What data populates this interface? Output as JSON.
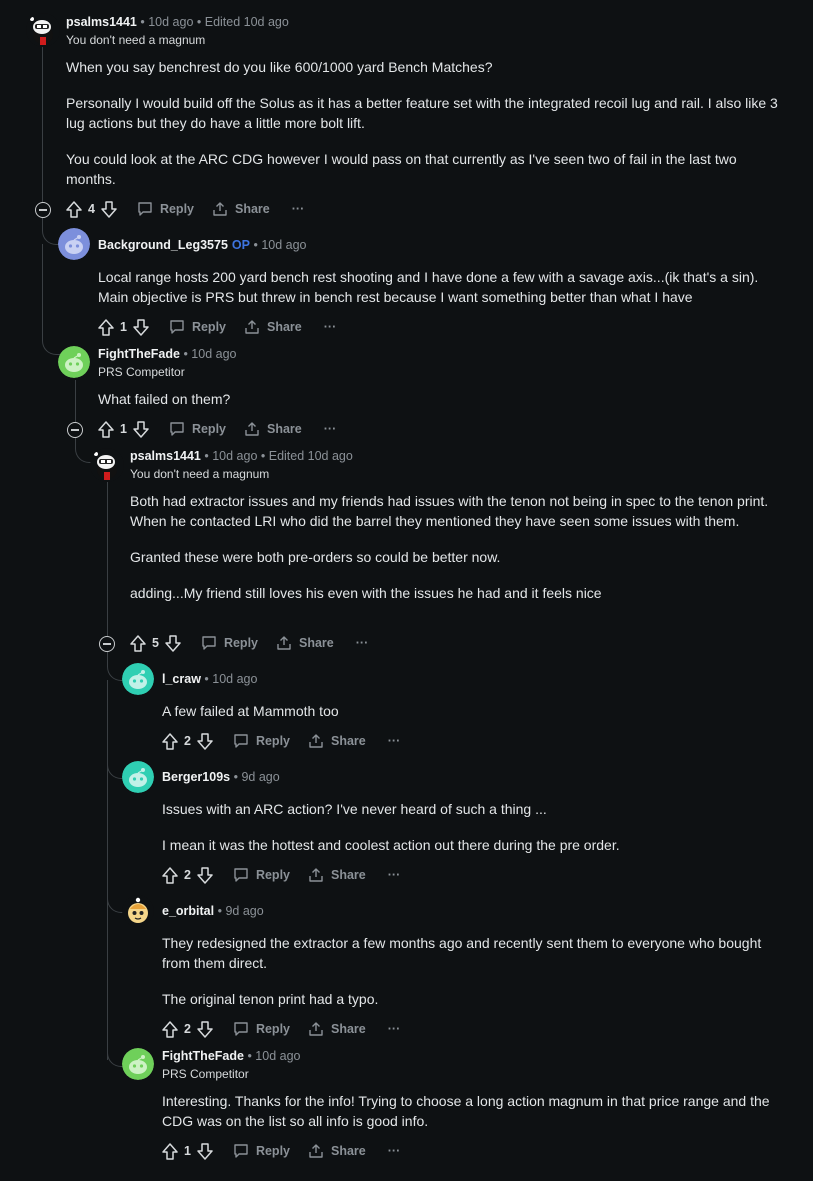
{
  "actions": {
    "reply": "Reply",
    "share": "Share",
    "more": "···"
  },
  "comments": [
    {
      "user": "psalms1441",
      "meta": "• 10d ago • Edited 10d ago",
      "flair": "You don't need a magnum",
      "paragraphs": [
        "When you say benchrest do you like 600/1000 yard Bench Matches?",
        "Personally I would build off the Solus as it has a better feature set with the integrated recoil lug and rail. I also like 3 lug actions but they do have a little more bolt lift.",
        "You could look at the ARC CDG however I would pass on that currently as I've seen two of fail in the last two months."
      ],
      "votes": "4"
    },
    {
      "user": "Background_Leg3575",
      "op": "OP",
      "meta": "• 10d ago",
      "paragraphs": [
        "Local range hosts 200 yard bench rest shooting and I have done a few with a savage axis...(ik that's a sin). Main objective is PRS but threw in bench rest because I want something better than what I have"
      ],
      "votes": "1"
    },
    {
      "user": "FightTheFade",
      "meta": "• 10d ago",
      "flair": "PRS Competitor",
      "paragraphs": [
        "What failed on them?"
      ],
      "votes": "1"
    },
    {
      "user": "psalms1441",
      "meta": "• 10d ago • Edited 10d ago",
      "flair": "You don't need a magnum",
      "paragraphs": [
        "Both had extractor issues and my friends had issues with the tenon not being in spec to the tenon print. When he contacted LRI who did the barrel they mentioned they have seen some issues with them.",
        "Granted these were both pre-orders so could be better now.",
        "adding...My friend still loves his even with the issues he had and it feels nice"
      ],
      "votes": "5"
    },
    {
      "user": "l_craw",
      "meta": "• 10d ago",
      "paragraphs": [
        "A few failed at Mammoth too"
      ],
      "votes": "2"
    },
    {
      "user": "Berger109s",
      "meta": "• 9d ago",
      "paragraphs": [
        "Issues with an ARC action? I've never heard of such a thing ...",
        "I mean it was the hottest and coolest action out there during the pre order."
      ],
      "votes": "2"
    },
    {
      "user": "e_orbital",
      "meta": "• 9d ago",
      "paragraphs": [
        "They redesigned the extractor a few months ago and recently sent them to everyone who bought from them direct.",
        "The original tenon print had a typo."
      ],
      "votes": "2"
    },
    {
      "user": "FightTheFade",
      "meta": "• 10d ago",
      "flair": "PRS Competitor",
      "paragraphs": [
        "Interesting. Thanks for the info! Trying to choose a long action magnum in that price range and the CDG was on the list so all info is good info."
      ],
      "votes": "1"
    }
  ]
}
